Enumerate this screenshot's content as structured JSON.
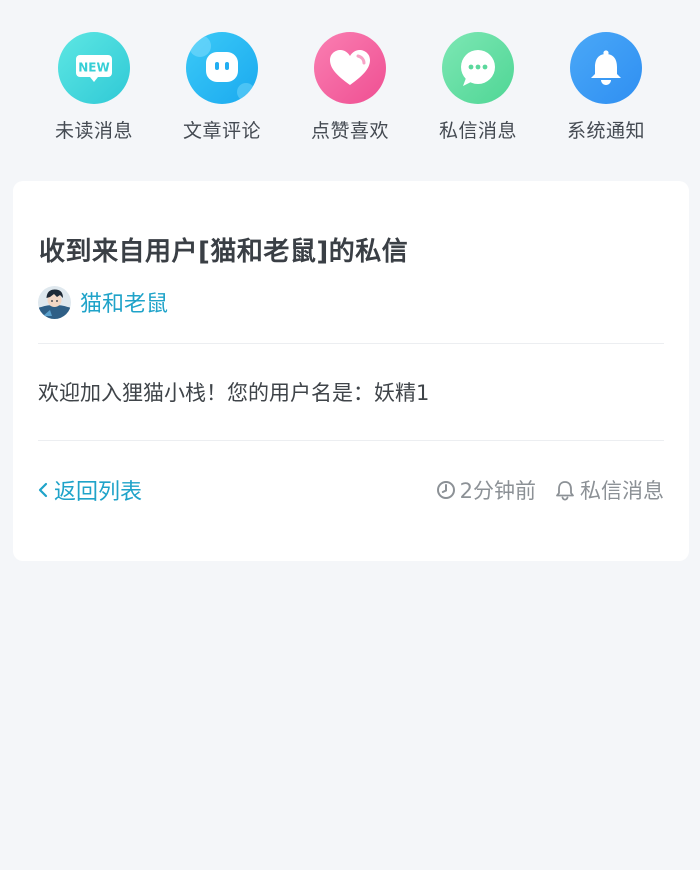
{
  "nav": {
    "items": [
      {
        "label": "未读消息",
        "icon": "new-badge-icon",
        "badge_text": "NEW",
        "color": "#3fd8dc"
      },
      {
        "label": "文章评论",
        "icon": "comment-face-icon",
        "color": "#29b6f6"
      },
      {
        "label": "点赞喜欢",
        "icon": "heart-icon",
        "color": "#f568a2"
      },
      {
        "label": "私信消息",
        "icon": "chat-bubble-icon",
        "color": "#5fdea0"
      },
      {
        "label": "系统通知",
        "icon": "bell-icon",
        "color": "#3d9cf5"
      }
    ]
  },
  "message": {
    "title": "收到来自用户[猫和老鼠]的私信",
    "author": "猫和老鼠",
    "body": "欢迎加入狸猫小栈！您的用户名是：妖精1",
    "back_label": "返回列表",
    "time": "2分钟前",
    "category": "私信消息"
  },
  "colors": {
    "accent": "#1fa3c9",
    "background": "#f4f6f9",
    "card": "#ffffff",
    "muted": "#8c9196"
  }
}
